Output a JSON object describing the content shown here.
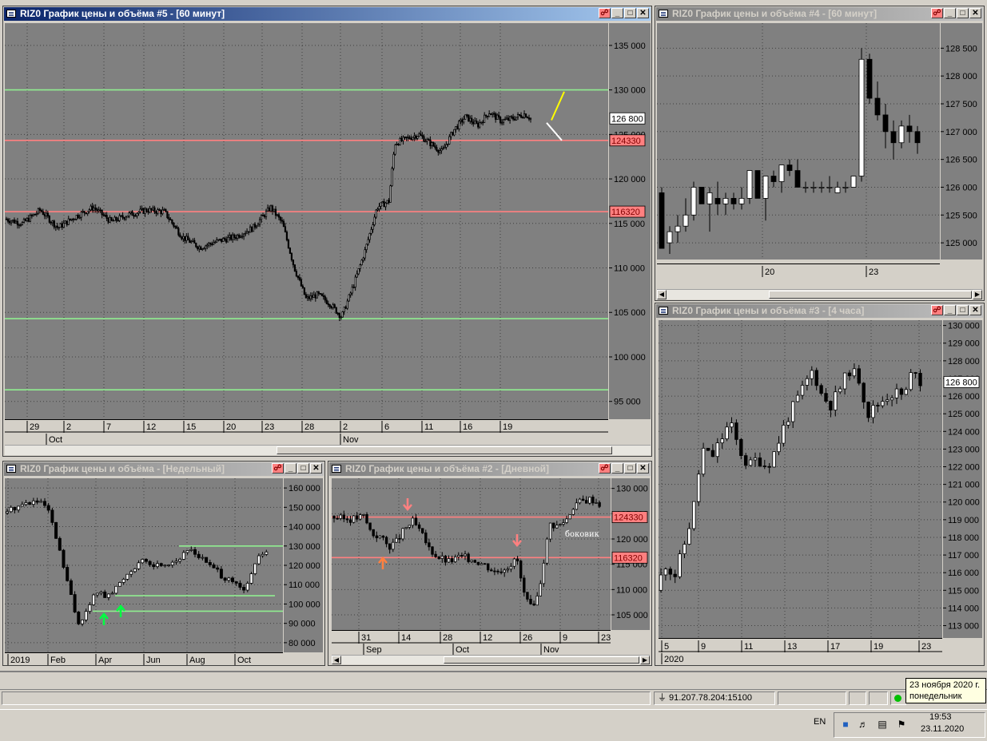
{
  "windows": {
    "w5": {
      "title": "RIZ0 График цены и объёма #5 - [60 минут]",
      "yticks": [
        "135 000",
        "130 000",
        "125 000",
        "120 000",
        "115 000",
        "110 000",
        "105 000",
        "100 000",
        "95 000"
      ],
      "xticks_top": [
        "29",
        "2",
        "7",
        "12",
        "15",
        "20",
        "23",
        "28",
        "2",
        "6",
        "11",
        "16",
        "19"
      ],
      "xticks_bottom": [
        "Oct",
        "Nov"
      ],
      "price_labels": [
        {
          "text": "126 800",
          "kind": "current"
        },
        {
          "text": "124330",
          "kind": "red"
        },
        {
          "text": "116320",
          "kind": "red"
        }
      ]
    },
    "w4": {
      "title": "RIZ0 График цены и объёма #4 - [60 минут]",
      "yticks": [
        "128 500",
        "128 000",
        "127 500",
        "127 000",
        "126 500",
        "126 000",
        "125 500",
        "125 000"
      ],
      "xticks": [
        "20",
        "23"
      ]
    },
    "w3": {
      "title": "RIZ0 График цены и объёма #3 - [4 часа]",
      "yticks": [
        "130 000",
        "129 000",
        "128 000",
        "127 000",
        "126 000",
        "125 000",
        "124 000",
        "123 000",
        "122 000",
        "121 000",
        "120 000",
        "119 000",
        "118 000",
        "117 000",
        "116 000",
        "115 000",
        "114 000",
        "113 000"
      ],
      "xticks_top": [
        "5",
        "9",
        "11",
        "13",
        "17",
        "19",
        "23"
      ],
      "xticks_bottom": [
        "2020"
      ],
      "price_labels": [
        {
          "text": "126 800",
          "kind": "current"
        }
      ]
    },
    "wW": {
      "title": "RIZ0 График цены и объёма - [Недельный]",
      "yticks": [
        "160 000",
        "150 000",
        "140 000",
        "130 000",
        "120 000",
        "110 000",
        "100 000",
        "90 000",
        "80 000"
      ],
      "xticks": [
        "2019",
        "Feb",
        "Apr",
        "Jun",
        "Aug",
        "Oct"
      ]
    },
    "w2": {
      "title": "RIZ0 График цены и объёма #2 - [Дневной]",
      "yticks": [
        "130 000",
        "125 000",
        "120 000",
        "115 000",
        "110 000",
        "105 000"
      ],
      "xticks_top": [
        "31",
        "14",
        "28",
        "12",
        "26",
        "9",
        "23"
      ],
      "xticks_bottom": [
        "Sep",
        "Oct",
        "Nov"
      ],
      "price_labels": [
        {
          "text": "124330",
          "kind": "red"
        },
        {
          "text": "116320",
          "kind": "red"
        }
      ],
      "note": "боковик"
    }
  },
  "statusbar": {
    "address": "91.207.78.204:15100"
  },
  "tooltip": {
    "line1": "23 ноября 2020 г.",
    "line2": "понедельник"
  },
  "tray": {
    "lang": "EN",
    "time": "19:53",
    "date": "23.11.2020"
  },
  "colors": {
    "chart_bg": "#808080",
    "green_level": "#90ee90",
    "red_level": "#ff8080",
    "active_title": "#0a246a"
  },
  "chart_data": [
    {
      "type": "candlestick",
      "id": "w5",
      "title": "RIZ0 График цены и объёма #5 - [60 минут]",
      "ylim": [
        93000,
        137500
      ],
      "horizontal_levels": [
        {
          "y": 130000,
          "color": "green"
        },
        {
          "y": 124330,
          "color": "red"
        },
        {
          "y": 116320,
          "color": "red"
        },
        {
          "y": 104300,
          "color": "green"
        },
        {
          "y": 96300,
          "color": "green"
        }
      ],
      "approx_close_path": [
        [
          0,
          115500
        ],
        [
          0.03,
          115000
        ],
        [
          0.06,
          116500
        ],
        [
          0.09,
          114500
        ],
        [
          0.12,
          115800
        ],
        [
          0.15,
          116800
        ],
        [
          0.18,
          115200
        ],
        [
          0.21,
          116000
        ],
        [
          0.24,
          116500
        ],
        [
          0.27,
          116300
        ],
        [
          0.3,
          113500
        ],
        [
          0.33,
          112300
        ],
        [
          0.36,
          113000
        ],
        [
          0.39,
          113500
        ],
        [
          0.42,
          114500
        ],
        [
          0.45,
          116800
        ],
        [
          0.47,
          115000
        ],
        [
          0.49,
          110000
        ],
        [
          0.51,
          106500
        ],
        [
          0.53,
          107000
        ],
        [
          0.55,
          106000
        ],
        [
          0.57,
          104500
        ],
        [
          0.59,
          108000
        ],
        [
          0.61,
          112000
        ],
        [
          0.63,
          116800
        ],
        [
          0.65,
          117500
        ],
        [
          0.66,
          124000
        ],
        [
          0.68,
          124500
        ],
        [
          0.7,
          125000
        ],
        [
          0.72,
          124000
        ],
        [
          0.74,
          123000
        ],
        [
          0.76,
          125500
        ],
        [
          0.78,
          127000
        ],
        [
          0.8,
          126000
        ],
        [
          0.82,
          127500
        ],
        [
          0.84,
          126500
        ],
        [
          0.86,
          126800
        ],
        [
          0.88,
          127300
        ],
        [
          0.89,
          126800
        ]
      ],
      "last_price": 126800
    },
    {
      "type": "candlestick",
      "id": "w4",
      "title": "RIZ0 График цены и объёма #4 - [60 минут]",
      "ylim": [
        124700,
        128950
      ],
      "candles_ohlc": [
        [
          125900,
          126000,
          124900,
          124900
        ],
        [
          125000,
          125300,
          124800,
          125200
        ],
        [
          125200,
          125500,
          125000,
          125300
        ],
        [
          125300,
          125800,
          125200,
          125500
        ],
        [
          125500,
          126100,
          125400,
          126000
        ],
        [
          126000,
          126000,
          125700,
          125700
        ],
        [
          125700,
          126000,
          125200,
          125900
        ],
        [
          125800,
          126100,
          125500,
          125700
        ],
        [
          125700,
          125900,
          125500,
          125800
        ],
        [
          125800,
          125900,
          125600,
          125700
        ],
        [
          125700,
          126000,
          125600,
          125800
        ],
        [
          125800,
          126300,
          125700,
          126300
        ],
        [
          126300,
          126300,
          125800,
          125800
        ],
        [
          125800,
          126200,
          125400,
          126200
        ],
        [
          126200,
          126300,
          126000,
          126100
        ],
        [
          126100,
          126400,
          125900,
          126400
        ],
        [
          126400,
          126500,
          126200,
          126300
        ],
        [
          126300,
          126500,
          126000,
          126000
        ],
        [
          126000,
          126100,
          125900,
          126000
        ],
        [
          126000,
          126100,
          125900,
          126000
        ],
        [
          126000,
          126100,
          125900,
          126000
        ],
        [
          126000,
          126200,
          125900,
          126000
        ],
        [
          125900,
          126100,
          125900,
          126000
        ],
        [
          126000,
          126100,
          125900,
          126000
        ],
        [
          126000,
          126200,
          126000,
          126200
        ],
        [
          126200,
          128500,
          126100,
          128300
        ],
        [
          128300,
          128400,
          127500,
          127600
        ],
        [
          127600,
          127900,
          127200,
          127300
        ],
        [
          127300,
          127500,
          126700,
          127000
        ],
        [
          127000,
          127200,
          126500,
          126800
        ],
        [
          126800,
          127200,
          126700,
          127100
        ],
        [
          127100,
          127300,
          126800,
          127000
        ],
        [
          127000,
          127100,
          126600,
          126800
        ]
      ]
    },
    {
      "type": "candlestick",
      "id": "w3",
      "title": "RIZ0 График цены и объёма #3 - [4 часа]",
      "ylim": [
        112300,
        130300
      ],
      "approx_close_path": [
        [
          0,
          115000
        ],
        [
          0.03,
          116500
        ],
        [
          0.06,
          115800
        ],
        [
          0.09,
          117500
        ],
        [
          0.12,
          119500
        ],
        [
          0.15,
          123000
        ],
        [
          0.18,
          122500
        ],
        [
          0.21,
          123500
        ],
        [
          0.24,
          124500
        ],
        [
          0.27,
          123000
        ],
        [
          0.3,
          122000
        ],
        [
          0.33,
          122500
        ],
        [
          0.36,
          122000
        ],
        [
          0.39,
          123000
        ],
        [
          0.42,
          124500
        ],
        [
          0.45,
          125500
        ],
        [
          0.48,
          126500
        ],
        [
          0.51,
          127500
        ],
        [
          0.54,
          126000
        ],
        [
          0.57,
          125500
        ],
        [
          0.6,
          126500
        ],
        [
          0.63,
          127500
        ],
        [
          0.66,
          127000
        ],
        [
          0.69,
          125000
        ],
        [
          0.72,
          125500
        ],
        [
          0.75,
          126000
        ],
        [
          0.78,
          126200
        ],
        [
          0.81,
          126000
        ],
        [
          0.84,
          127800
        ],
        [
          0.86,
          126800
        ]
      ],
      "last_price": 126800
    },
    {
      "type": "candlestick",
      "id": "wW",
      "title": "RIZ0 График цены и объёма - [Недельный]",
      "ylim": [
        75000,
        165000
      ],
      "horizontal_levels": [
        {
          "y": 130000,
          "color": "green"
        },
        {
          "y": 104300,
          "color": "green"
        },
        {
          "y": 96300,
          "color": "green"
        }
      ],
      "approx_close_path": [
        [
          0,
          147000
        ],
        [
          0.04,
          150000
        ],
        [
          0.08,
          152000
        ],
        [
          0.12,
          153000
        ],
        [
          0.16,
          150000
        ],
        [
          0.2,
          130000
        ],
        [
          0.24,
          108000
        ],
        [
          0.27,
          90000
        ],
        [
          0.3,
          95000
        ],
        [
          0.34,
          107000
        ],
        [
          0.38,
          103000
        ],
        [
          0.42,
          110000
        ],
        [
          0.46,
          117000
        ],
        [
          0.5,
          122000
        ],
        [
          0.55,
          120000
        ],
        [
          0.6,
          121000
        ],
        [
          0.65,
          124000
        ],
        [
          0.68,
          129000
        ],
        [
          0.72,
          124000
        ],
        [
          0.77,
          118000
        ],
        [
          0.81,
          113000
        ],
        [
          0.85,
          110000
        ],
        [
          0.88,
          106000
        ],
        [
          0.91,
          118000
        ],
        [
          0.94,
          126000
        ],
        [
          0.96,
          127000
        ]
      ]
    },
    {
      "type": "candlestick",
      "id": "w2",
      "title": "RIZ0 График цены и объёма #2 - [Дневной]",
      "ylim": [
        102000,
        132000
      ],
      "horizontal_levels": [
        {
          "y": 124330,
          "color": "red"
        },
        {
          "y": 116320,
          "color": "red"
        }
      ],
      "annotations": [
        "боковик"
      ],
      "approx_close_path": [
        [
          0,
          124500
        ],
        [
          0.04,
          124000
        ],
        [
          0.08,
          124000
        ],
        [
          0.12,
          124500
        ],
        [
          0.15,
          121000
        ],
        [
          0.18,
          120500
        ],
        [
          0.21,
          118500
        ],
        [
          0.24,
          119500
        ],
        [
          0.27,
          122000
        ],
        [
          0.3,
          123500
        ],
        [
          0.33,
          121000
        ],
        [
          0.36,
          118000
        ],
        [
          0.39,
          116500
        ],
        [
          0.43,
          115500
        ],
        [
          0.47,
          116500
        ],
        [
          0.52,
          116000
        ],
        [
          0.56,
          115000
        ],
        [
          0.6,
          113500
        ],
        [
          0.64,
          114500
        ],
        [
          0.68,
          116000
        ],
        [
          0.7,
          110000
        ],
        [
          0.72,
          107000
        ],
        [
          0.74,
          106000
        ],
        [
          0.76,
          110000
        ],
        [
          0.78,
          117000
        ],
        [
          0.8,
          123000
        ],
        [
          0.83,
          122500
        ],
        [
          0.86,
          124000
        ],
        [
          0.89,
          127000
        ],
        [
          0.92,
          127500
        ],
        [
          0.95,
          128000
        ],
        [
          0.98,
          127000
        ]
      ]
    }
  ]
}
